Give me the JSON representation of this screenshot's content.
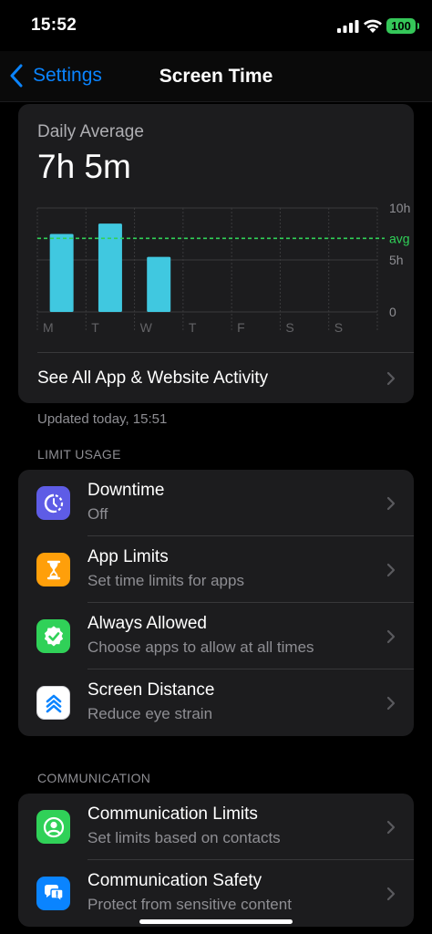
{
  "status": {
    "time": "15:52",
    "battery": "100"
  },
  "nav": {
    "back_label": "Settings",
    "title": "Screen Time"
  },
  "summary": {
    "label": "Daily Average",
    "value": "7h 5m",
    "activity_label": "See All App & Website Activity",
    "updated": "Updated today, 15:51"
  },
  "chart_data": {
    "type": "bar",
    "categories": [
      "M",
      "T",
      "W",
      "T",
      "F",
      "S",
      "S"
    ],
    "values": [
      7.5,
      8.5,
      5.3,
      0,
      0,
      0,
      0
    ],
    "average": 7.08,
    "ylim": [
      0,
      10
    ],
    "y_ticks": [
      "10h",
      "5h",
      "0"
    ],
    "avg_label": "avg",
    "colors": {
      "bar": "#40c8e0",
      "avg_line": "#30d158",
      "grid": "#3a3a3c"
    }
  },
  "limit_usage": {
    "header": "LIMIT USAGE",
    "items": [
      {
        "title": "Downtime",
        "subtitle": "Off",
        "icon": "downtime-icon",
        "color": "#5e5ce6"
      },
      {
        "title": "App Limits",
        "subtitle": "Set time limits for apps",
        "icon": "hourglass-icon",
        "color": "#ff9f0a"
      },
      {
        "title": "Always Allowed",
        "subtitle": "Choose apps to allow at all times",
        "icon": "checkmark-seal-icon",
        "color": "#30d158"
      },
      {
        "title": "Screen Distance",
        "subtitle": "Reduce eye strain",
        "icon": "chevrons-up-icon",
        "color": "#ffffff"
      }
    ]
  },
  "communication": {
    "header": "COMMUNICATION",
    "items": [
      {
        "title": "Communication Limits",
        "subtitle": "Set limits based on contacts",
        "icon": "person-circle-icon",
        "color": "#30d158"
      },
      {
        "title": "Communication Safety",
        "subtitle": "Protect from sensitive content",
        "icon": "chat-bubble-icon",
        "color": "#0a84ff"
      }
    ]
  }
}
